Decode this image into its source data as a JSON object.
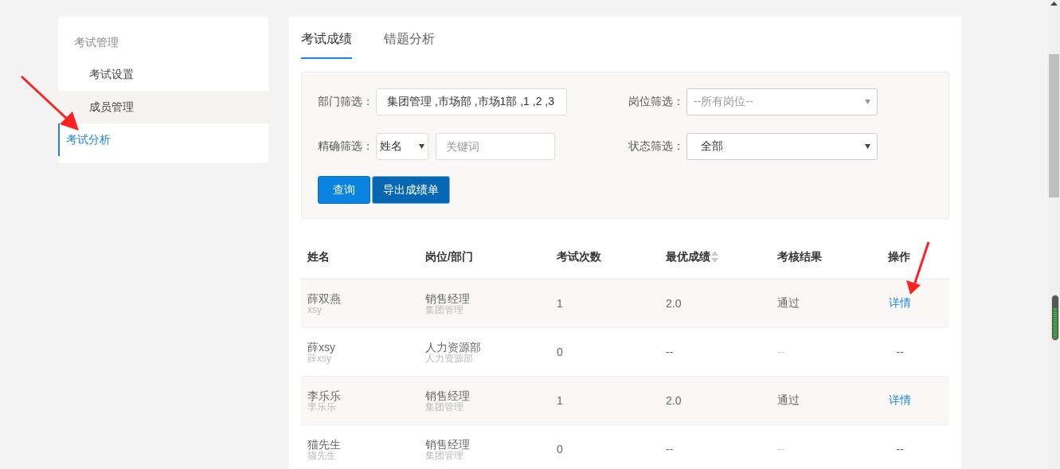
{
  "sidebar": {
    "title": "考试管理",
    "items": [
      {
        "label": "考试设置",
        "selected": false,
        "hovered": false
      },
      {
        "label": "成员管理",
        "selected": false,
        "hovered": true
      },
      {
        "label": "考试分析",
        "selected": true,
        "hovered": false
      }
    ]
  },
  "tabs": [
    {
      "label": "考试成绩",
      "selected": true
    },
    {
      "label": "错题分析",
      "selected": false
    }
  ],
  "filters": [
    {
      "kind": "text",
      "label": "部门筛选：",
      "value": "集团管理 ,市场部 ,市场1部 ,1 ,2 ,3"
    },
    {
      "kind": "select",
      "label": "岗位筛选：",
      "placeholder": "--所有岗位--"
    },
    {
      "kind": "select-search",
      "label": "精确筛选：",
      "value": "姓名",
      "placeholder": "关键词"
    },
    {
      "kind": "select",
      "label": "状态筛选：",
      "value": "全部"
    }
  ],
  "buttons": [
    {
      "label": "查询",
      "kind": "primary"
    },
    {
      "label": "导出成绩单",
      "kind": "export"
    }
  ],
  "table": {
    "columns": [
      {
        "label": "姓名",
        "sortable": false
      },
      {
        "label": "岗位/部门",
        "sortable": false
      },
      {
        "label": "考试次数",
        "sortable": false
      },
      {
        "label": "最优成绩",
        "sortable": true
      },
      {
        "label": "考核结果",
        "sortable": false
      },
      {
        "label": "操作",
        "sortable": false
      }
    ],
    "rows": [
      {
        "name": "薛双燕",
        "account": "xsy",
        "position": "销售经理",
        "department": "集团管理",
        "attempts": "1",
        "best_score": "2.0",
        "result": "通过",
        "action": {
          "text": "详情",
          "kind": "link"
        }
      },
      {
        "name": "薛xsy",
        "account": "薛xsy",
        "position": "人力资源部",
        "department": "人力资源部",
        "attempts": "0",
        "best_score": "--",
        "result": "--",
        "action": {
          "text": "--",
          "kind": "text"
        }
      },
      {
        "name": "李乐乐",
        "account": "李乐乐",
        "position": "销售经理",
        "department": "集团管理",
        "attempts": "1",
        "best_score": "2.0",
        "result": "通过",
        "action": {
          "text": "详情",
          "kind": "link"
        }
      },
      {
        "name": "猫先生",
        "account": "猫先生",
        "position": "销售经理",
        "department": "集团管理",
        "attempts": "0",
        "best_score": "--",
        "result": "--",
        "action": {
          "text": "--",
          "kind": "text"
        }
      }
    ]
  }
}
